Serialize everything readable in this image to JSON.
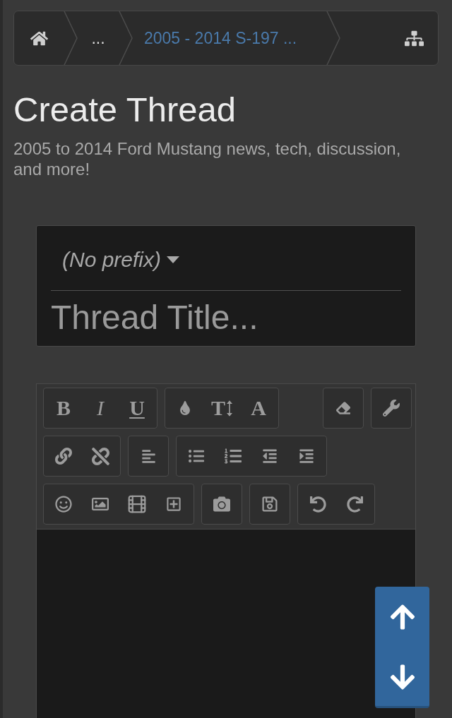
{
  "breadcrumb": {
    "items": [
      {
        "kind": "home"
      },
      {
        "kind": "more",
        "label": "..."
      },
      {
        "kind": "forum",
        "label": "2005 - 2014 S-197 ..."
      }
    ]
  },
  "header": {
    "title": "Create Thread",
    "description": "2005 to 2014 Ford Mustang news, tech, discussion, and more!"
  },
  "thread_form": {
    "prefix": "(No prefix)",
    "title_placeholder": "Thread Title..."
  },
  "editor": {
    "toolbar_rows": [
      {
        "left_groups": [
          [
            {
              "kind": "bold",
              "label": "B"
            },
            {
              "kind": "italic",
              "label": "I"
            },
            {
              "kind": "underline",
              "label": "U"
            }
          ],
          [
            {
              "kind": "color"
            },
            {
              "kind": "size",
              "label": "T"
            },
            {
              "kind": "font",
              "label": "A"
            }
          ]
        ],
        "right_groups": [
          [
            {
              "kind": "remove_format"
            }
          ],
          [
            {
              "kind": "tools"
            }
          ]
        ]
      },
      {
        "left_groups": [
          [
            {
              "kind": "link"
            },
            {
              "kind": "unlink"
            }
          ],
          [
            {
              "kind": "align_left"
            }
          ],
          [
            {
              "kind": "bullet_list"
            },
            {
              "kind": "numbered_list"
            },
            {
              "kind": "outdent"
            },
            {
              "kind": "indent"
            }
          ]
        ]
      },
      {
        "left_groups": [
          [
            {
              "kind": "smilies"
            },
            {
              "kind": "image"
            },
            {
              "kind": "media"
            },
            {
              "kind": "insert"
            }
          ],
          [
            {
              "kind": "camera"
            }
          ],
          [
            {
              "kind": "save"
            }
          ],
          [
            {
              "kind": "undo"
            },
            {
              "kind": "redo"
            }
          ]
        ]
      }
    ]
  }
}
